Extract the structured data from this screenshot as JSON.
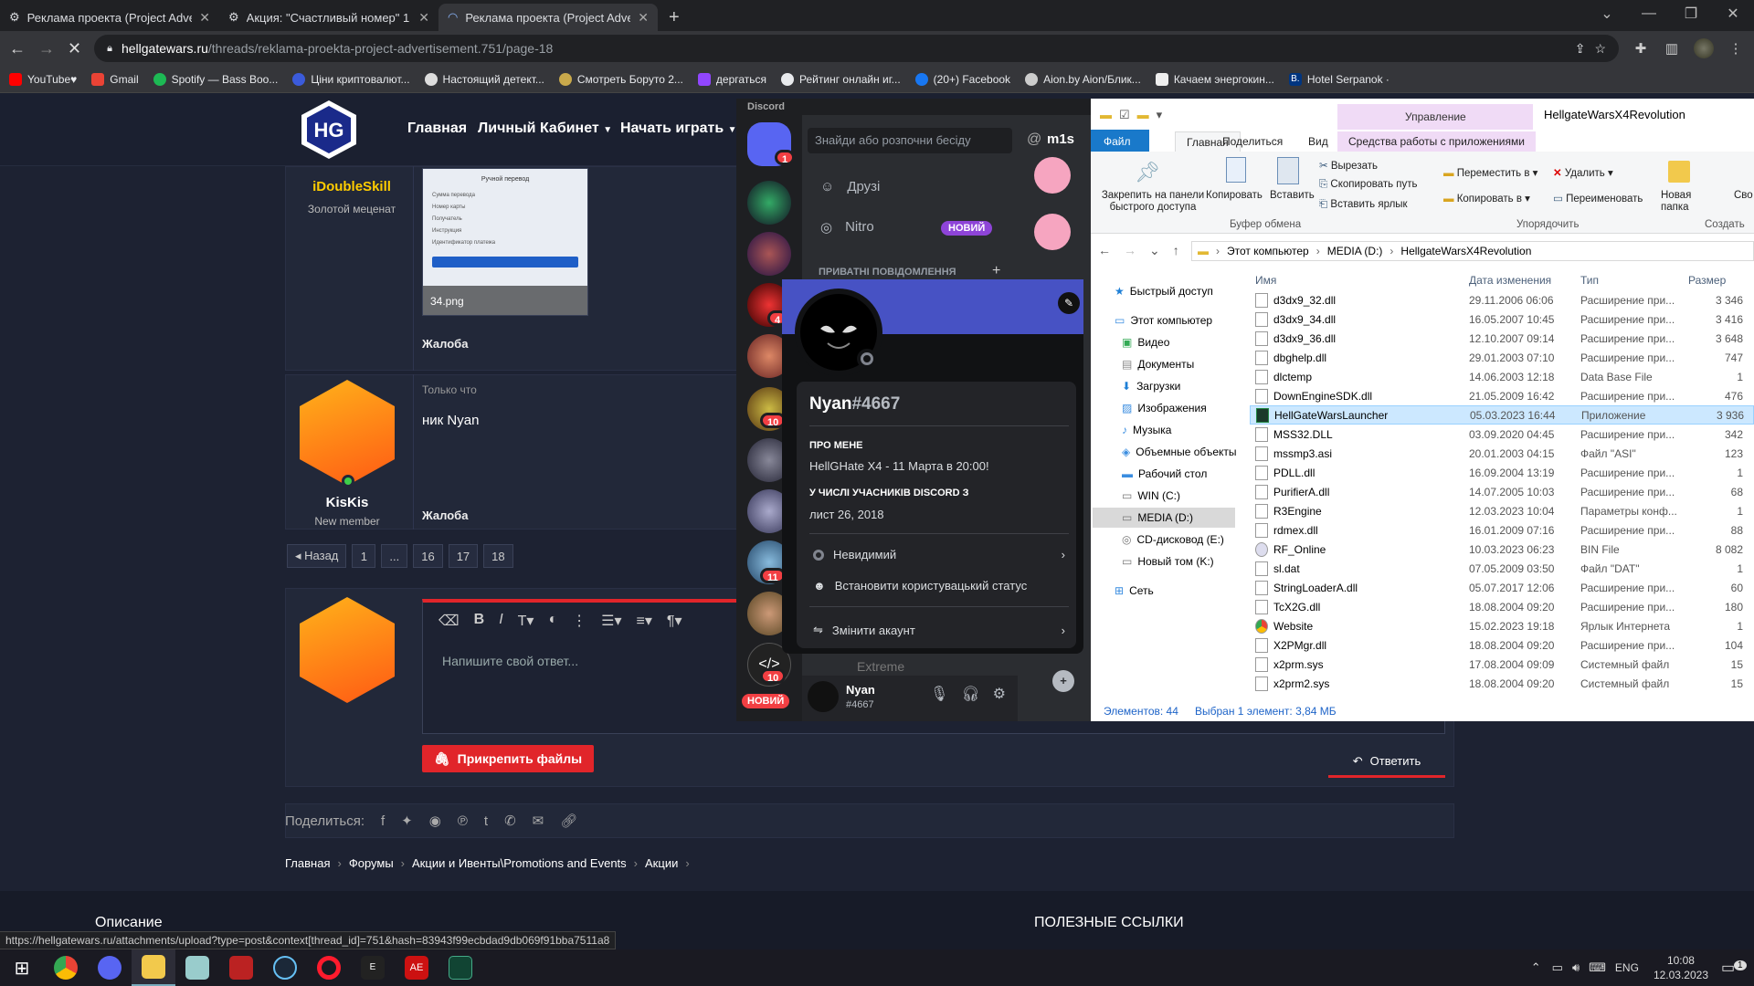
{
  "browser": {
    "tabs": [
      {
        "title": "Реклама проекта (Project Adver",
        "active": false
      },
      {
        "title": "Акция: \"Счастливый номер\" 1 т",
        "active": false
      },
      {
        "title": "Реклама проекта (Project Adver",
        "active": true
      }
    ],
    "url_host": "hellgatewars.ru",
    "url_path": "/threads/reklama-proekta-project-advertisement.751/page-18",
    "bookmarks": [
      "YouTube♥",
      "Gmail",
      "Spotify — Bass Boo...",
      "Ціни криптовалют...",
      "Настоящий детект...",
      "Смотреть Боруто 2...",
      "дергаться",
      "Рейтинг онлайн иг...",
      "(20+) Facebook",
      "Aion.by Aion/Блик...",
      "Качаем энергокин...",
      "Hotel Serpanok ·"
    ],
    "status_url": "https://hellgatewars.ru/attachments/upload?type=post&context[thread_id]=751&hash=83943f99ecbdad9db069f91bba7511a8"
  },
  "site": {
    "nav": [
      "Главная",
      "Личный Кабинет",
      "Начать играть"
    ],
    "post1": {
      "username": "iDoubleSkill",
      "rank": "Золотой меценат",
      "attachment": "34.png",
      "report": "Жалоба",
      "thumb_title": "Ручной перевод",
      "thumb_rows": [
        "Сумма перевода",
        "Номер карты",
        "Получатель",
        "Инструкция",
        "Идентификатор платежа"
      ]
    },
    "post2": {
      "username": "KisKis",
      "rank": "New member",
      "time": "Только что",
      "text": "ник Nyan",
      "report": "Жалоба"
    },
    "pagination": [
      "◂ Назад",
      "1",
      "...",
      "16",
      "17",
      "18"
    ],
    "reply_placeholder": "Напишите свой ответ...",
    "attach_label": "Прикрепить файлы",
    "reply_label": "Ответить",
    "share_label": "Поделиться:",
    "breadcrumbs": [
      "Главная",
      "Форумы",
      "Акции и Ивенты\\Promotions and Events",
      "Акции"
    ],
    "footer_left": "Описание",
    "footer_right": "ПОЛЕЗНЫЕ ССЫЛКИ"
  },
  "discord": {
    "brand": "Discord",
    "search": "Знайди або розпочни бесіду",
    "friends": "Друзі",
    "nitro": "Nitro",
    "new_badge": "НОВИЙ",
    "dm_header": "ПРИВАТНІ ПОВІДОМЛЕННЯ",
    "at_label": "m1s",
    "extreme": "Extreme",
    "server_badges": [
      "1",
      "4",
      "10",
      "11",
      "10"
    ],
    "new_server": "НОВИЙ",
    "profile": {
      "name": "Nyan",
      "tag": "#4667",
      "about_label": "ПРО МЕНЕ",
      "about": "HellGHate X4 - 11 Марта в 20:00!",
      "member_label": "У ЧИСЛІ УЧАСНИКІВ DISCORD З",
      "member_since": "лист 26, 2018",
      "status": "Невидимий",
      "set_status": "Встановити користувацький статус",
      "switch": "Змінити акаунт"
    },
    "user": {
      "name": "Nyan",
      "tag": "#4667"
    }
  },
  "explorer": {
    "window_title": "HellgateWarsX4Revolution",
    "manage_tab": "Управление",
    "app_tools": "Средства работы с приложениями",
    "ribbon_tabs": [
      "Файл",
      "Главная",
      "Поделиться",
      "Вид"
    ],
    "ribbon": {
      "pin": "Закрепить на панели быстрого доступа",
      "copy": "Копировать",
      "paste": "Вставить",
      "cut": "Вырезать",
      "copy_path": "Скопировать путь",
      "paste_link": "Вставить ярлык",
      "clipboard": "Буфер обмена",
      "move_to": "Переместить в",
      "copy_to": "Копировать в",
      "delete": "Удалить",
      "rename": "Переименовать",
      "organize": "Упорядочить",
      "new_folder": "Новая папка",
      "create": "Создать",
      "more": "Сво"
    },
    "path": [
      "Этот компьютер",
      "MEDIA (D:)",
      "HellgateWarsX4Revolution"
    ],
    "columns": [
      "Имя",
      "Дата изменения",
      "Тип",
      "Размер"
    ],
    "tree": [
      "Быстрый доступ",
      "Этот компьютер",
      "Видео",
      "Документы",
      "Загрузки",
      "Изображения",
      "Музыка",
      "Объемные объекты",
      "Рабочий стол",
      "WIN (C:)",
      "MEDIA (D:)",
      "CD-дисковод (E:)",
      "Новый том (K:)",
      "Сеть"
    ],
    "files": [
      {
        "name": "d3dx9_32.dll",
        "date": "29.11.2006 06:06",
        "type": "Расширение при...",
        "size": "3 346"
      },
      {
        "name": "d3dx9_34.dll",
        "date": "16.05.2007 10:45",
        "type": "Расширение при...",
        "size": "3 416"
      },
      {
        "name": "d3dx9_36.dll",
        "date": "12.10.2007 09:14",
        "type": "Расширение при...",
        "size": "3 648"
      },
      {
        "name": "dbghelp.dll",
        "date": "29.01.2003 07:10",
        "type": "Расширение при...",
        "size": "747"
      },
      {
        "name": "dlctemp",
        "date": "14.06.2003 12:18",
        "type": "Data Base File",
        "size": "1"
      },
      {
        "name": "DownEngineSDK.dll",
        "date": "21.05.2009 16:42",
        "type": "Расширение при...",
        "size": "476"
      },
      {
        "name": "HellGateWarsLauncher",
        "date": "05.03.2023 16:44",
        "type": "Приложение",
        "size": "3 936"
      },
      {
        "name": "MSS32.DLL",
        "date": "03.09.2020 04:45",
        "type": "Расширение при...",
        "size": "342"
      },
      {
        "name": "mssmp3.asi",
        "date": "20.01.2003 04:15",
        "type": "Файл \"ASI\"",
        "size": "123"
      },
      {
        "name": "PDLL.dll",
        "date": "16.09.2004 13:19",
        "type": "Расширение при...",
        "size": "1"
      },
      {
        "name": "PurifierA.dll",
        "date": "14.07.2005 10:03",
        "type": "Расширение при...",
        "size": "68"
      },
      {
        "name": "R3Engine",
        "date": "12.03.2023 10:04",
        "type": "Параметры конф...",
        "size": "1"
      },
      {
        "name": "rdmex.dll",
        "date": "16.01.2009 07:16",
        "type": "Расширение при...",
        "size": "88"
      },
      {
        "name": "RF_Online",
        "date": "10.03.2023 06:23",
        "type": "BIN File",
        "size": "8 082"
      },
      {
        "name": "sl.dat",
        "date": "07.05.2009 03:50",
        "type": "Файл \"DAT\"",
        "size": "1"
      },
      {
        "name": "StringLoaderA.dll",
        "date": "05.07.2017 12:06",
        "type": "Расширение при...",
        "size": "60"
      },
      {
        "name": "TcX2G.dll",
        "date": "18.08.2004 09:20",
        "type": "Расширение при...",
        "size": "180"
      },
      {
        "name": "Website",
        "date": "15.02.2023 19:18",
        "type": "Ярлык Интернета",
        "size": "1"
      },
      {
        "name": "X2PMgr.dll",
        "date": "18.08.2004 09:20",
        "type": "Расширение при...",
        "size": "104"
      },
      {
        "name": "x2prm.sys",
        "date": "17.08.2004 09:09",
        "type": "Системный файл",
        "size": "15"
      },
      {
        "name": "x2prm2.sys",
        "date": "18.08.2004 09:20",
        "type": "Системный файл",
        "size": "15"
      }
    ],
    "status_count": "Элементов: 44",
    "status_selected": "Выбран 1 элемент: 3,84 МБ"
  },
  "taskbar": {
    "lang": "ENG",
    "time": "10:08",
    "date": "12.03.2023",
    "notif": "1"
  }
}
